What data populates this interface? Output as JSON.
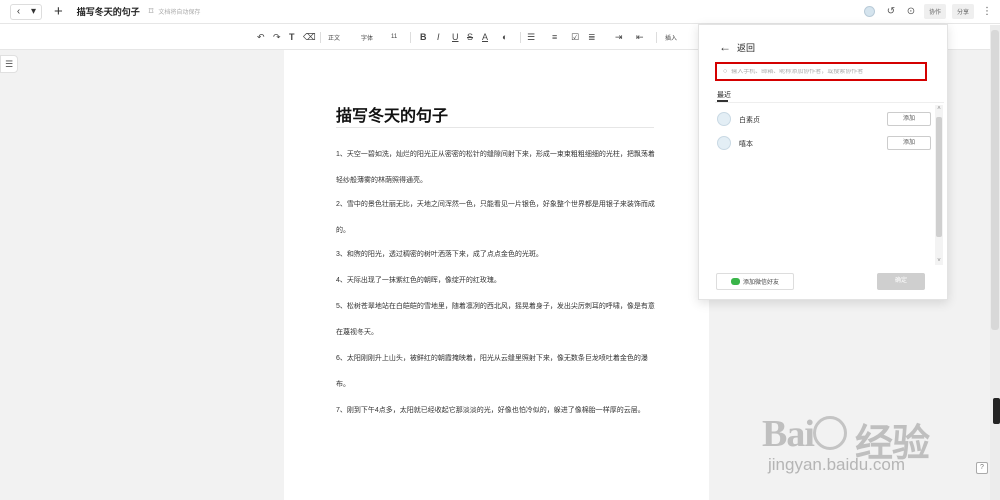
{
  "topbar": {
    "back": "‹",
    "menu": "▾",
    "plus": "+",
    "title": "描写冬天的句子",
    "bookmark": "⌑",
    "autosave": "文档将自动保存",
    "history_icon": "↺",
    "clock_icon": "⊙",
    "collab_label": "协作",
    "share_label": "分享",
    "more_icon": "⋮"
  },
  "toolbar": {
    "undo": "↶",
    "redo": "↷",
    "format": "T",
    "eraser": "⌫",
    "style": "正文",
    "font": "字体",
    "size": "11",
    "bold": "B",
    "italic": "I",
    "underline": "U",
    "strike": "S",
    "font_color": "A",
    "highlight": "◐",
    "list_ordered": "☰",
    "list_bullet": "≡",
    "checklist": "☑",
    "align": "≣",
    "indent_right": "⇥",
    "indent_left": "⇤",
    "insert": "插入"
  },
  "left_menu_icon": "☰",
  "document": {
    "title": "描写冬天的句子",
    "paragraphs": [
      "1、天空一碧如洗，灿烂的阳光正从密密的松针的缝隙间射下来，形成一束束粗粗细细的光柱，把飘荡着轻纱般薄雾的林荫照得通亮。",
      "2、雪中的景色壮丽无比，天地之间浑然一色，只能看见一片银色，好象整个世界都是用银子来装饰而成的。",
      "3、和煦的阳光，透过稠密的树叶洒落下来，成了点点金色的光斑。",
      "4、天际出现了一抹紫红色的朝晖，像绽开的红玫瑰。",
      "5、松树苍翠地站在白皑皑的雪地里，随着凛冽的西北风，摇晃着身子，发出尖厉刺耳的呼啸，像是有意在蔑视冬天。",
      "6、太阳刚刚升上山头，被鲜红的朝霞掩映着，阳光从云缝里照射下来，像无数条巨龙喷吐着金色的瀑布。",
      "7、刚到下午4点多，太阳就已经收起它那淡淡的光，好像也怕冷似的，躲进了像棉胎一样厚的云层。"
    ]
  },
  "collab_panel": {
    "back_icon": "←",
    "back_label": "返回",
    "search_icon": "○",
    "search_placeholder": "输入手机、邮箱、昵称添加协作者，或搜索协作者",
    "recent_tab": "最近",
    "contacts": [
      {
        "name": "白素贞",
        "action": "添加"
      },
      {
        "name": "嘻本",
        "action": "添加"
      }
    ],
    "scroll_up": "˄",
    "scroll_down": "˅",
    "wechat_label": "添加微信好友",
    "confirm_label": "确定"
  },
  "help_icon": "?",
  "watermark": {
    "brand": "Bai",
    "brand_suffix": "经验",
    "url": "jingyan.baidu.com"
  },
  "colors": {
    "highlight_red": "#d40000",
    "page_bg": "#ffffff",
    "app_bg": "#f2f2f2",
    "wechat_green": "#3ab54a"
  }
}
